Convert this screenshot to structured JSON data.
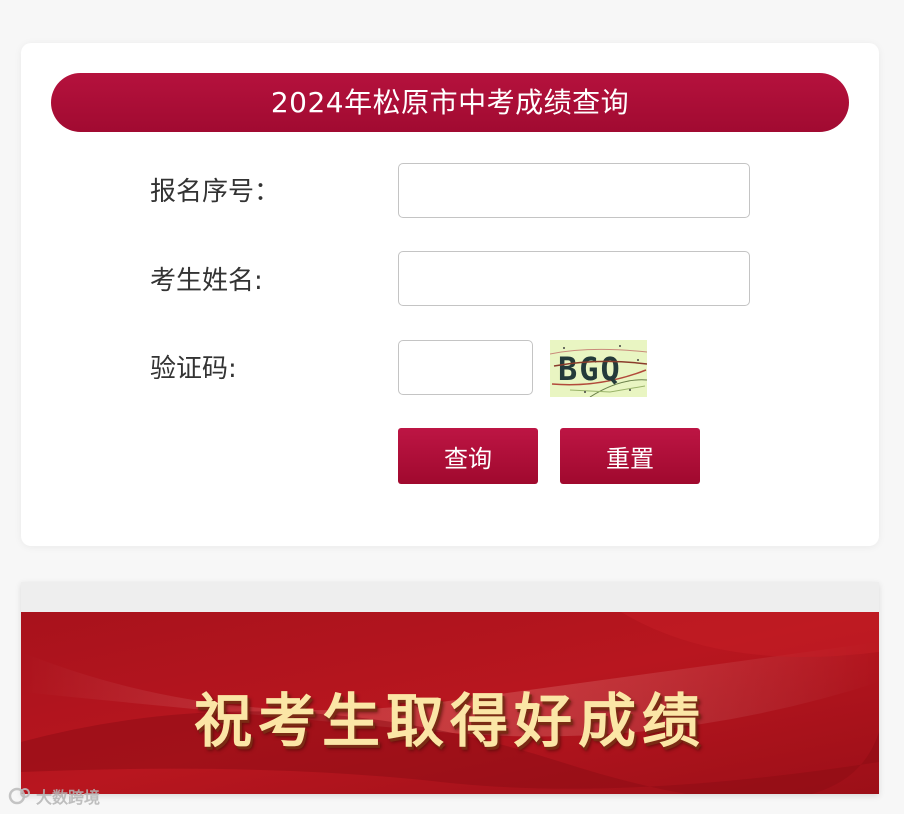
{
  "form": {
    "title": "2024年松原市中考成绩查询",
    "fields": [
      {
        "label": "报名序号：",
        "value": "",
        "placeholder": ""
      },
      {
        "label": "考生姓名:",
        "value": "",
        "placeholder": ""
      },
      {
        "label": "验证码:",
        "value": "",
        "placeholder": ""
      }
    ],
    "captcha_text": "BGQ",
    "query_button": "查询",
    "reset_button": "重置"
  },
  "banner": {
    "text": "祝考生取得好成绩"
  },
  "watermark": {
    "text": "大数跨境"
  },
  "colors": {
    "primary": "#a80c35",
    "banner_red": "#b3141f",
    "banner_text": "#fbe6a6"
  },
  "icons": {
    "watermark_logo": "brand-logo-icon"
  }
}
